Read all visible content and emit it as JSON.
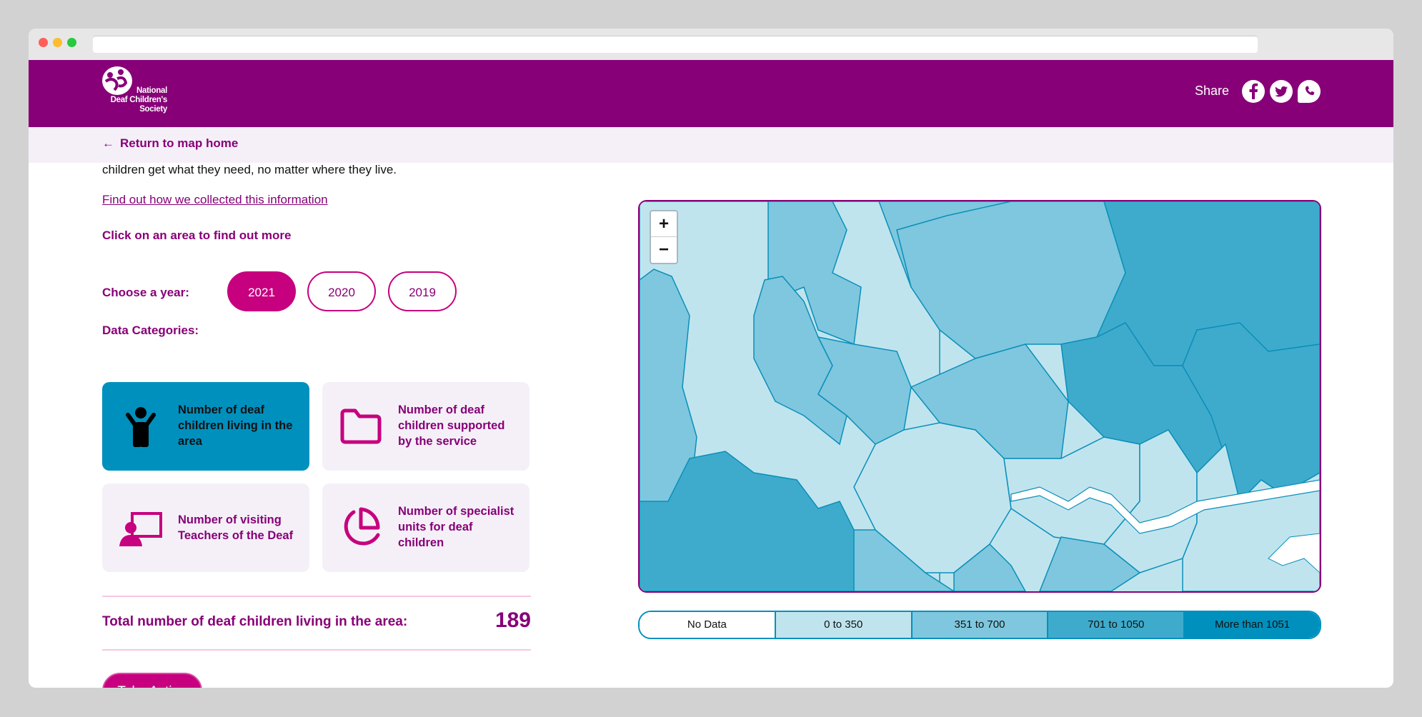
{
  "header": {
    "logo_lines": [
      "National",
      "Deaf Children's",
      "Society"
    ],
    "share_label": "Share",
    "social": [
      {
        "name": "facebook",
        "glyph": "f"
      },
      {
        "name": "twitter",
        "glyph": "t"
      },
      {
        "name": "whatsapp",
        "glyph": "w"
      }
    ]
  },
  "subnav": {
    "back_label": "Return to map home",
    "back_icon": "arrow-left-icon"
  },
  "content": {
    "intro_text": "children get what they need, no matter where they live.",
    "method_link": "Find out how we collected this information",
    "click_hint": "Click on an area to find out more",
    "year_label": "Choose a year:",
    "years": [
      {
        "label": "2021",
        "active": true
      },
      {
        "label": "2020",
        "active": false
      },
      {
        "label": "2019",
        "active": false
      }
    ],
    "categories_label": "Data Categories:",
    "categories": [
      {
        "label": "Number of deaf children living in the area",
        "icon": "child-icon",
        "active": true
      },
      {
        "label": "Number of deaf children supported by the service",
        "icon": "folder-icon",
        "active": false
      },
      {
        "label": "Number of visiting Teachers of the Deaf",
        "icon": "teacher-icon",
        "active": false
      },
      {
        "label": "Number of specialist units for deaf children",
        "icon": "pie-chart-icon",
        "active": false
      }
    ],
    "total_label": "Total number of deaf children living in the area:",
    "total_value": "189",
    "take_action_label": "Take Action"
  },
  "map": {
    "zoom_in_label": "+",
    "zoom_out_label": "−",
    "legend": [
      {
        "label": "No Data",
        "color": "#ffffff"
      },
      {
        "label": "0 to 350",
        "color": "#c0e4ee"
      },
      {
        "label": "351 to 700",
        "color": "#7fc7de"
      },
      {
        "label": "701 to 1050",
        "color": "#3fabcc"
      },
      {
        "label": "More than 1051",
        "color": "#0090be"
      }
    ],
    "border_color": "#0a8fb9"
  },
  "colors": {
    "brand_purple": "#870077",
    "brand_magenta": "#c6007e",
    "active_card": "#0090be",
    "card_bg": "#f5f0f8"
  }
}
